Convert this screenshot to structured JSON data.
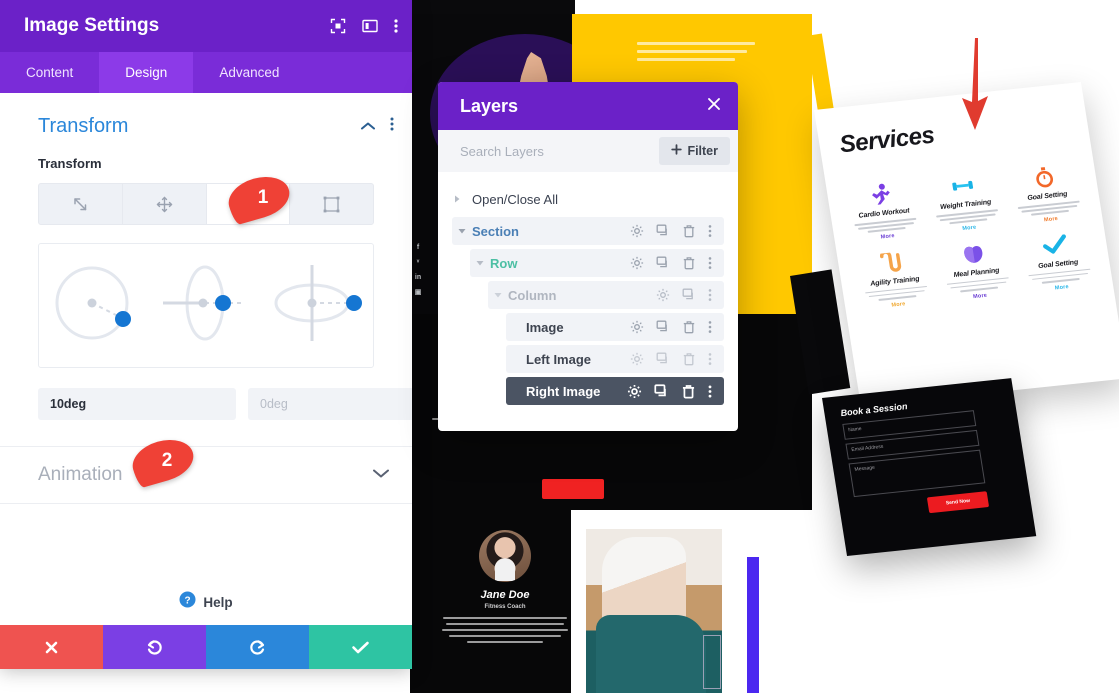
{
  "settings_panel": {
    "title": "Image Settings",
    "header_icons": [
      {
        "name": "focus-target-icon",
        "label": "Focus"
      },
      {
        "name": "panel-layout-icon",
        "label": "Panel Layout"
      },
      {
        "name": "kebab-menu-icon",
        "label": "More Options"
      }
    ],
    "tabs": [
      {
        "label": "Content",
        "active": false
      },
      {
        "label": "Design",
        "active": true
      },
      {
        "label": "Advanced",
        "active": false
      }
    ],
    "transform_section": {
      "heading": "Transform",
      "collapse_icon": "chevron-up-icon",
      "options_icon": "kebab-menu-icon",
      "sub_label": "Transform",
      "mode_buttons": [
        {
          "name": "scale",
          "icon": "scale-diagonal-icon",
          "active": false
        },
        {
          "name": "translate",
          "icon": "move-cross-icon",
          "active": false
        },
        {
          "name": "rotate",
          "icon": "rotate-circular-arrow-icon",
          "active": true
        },
        {
          "name": "skew",
          "icon": "skew-frame-icon",
          "active": false
        }
      ],
      "rotate_controls": [
        {
          "axis": "z",
          "label": "Rotate Z"
        },
        {
          "axis": "y",
          "label": "Rotate Y"
        },
        {
          "axis": "x",
          "label": "Rotate X"
        }
      ],
      "inputs": [
        {
          "name": "rotate-z",
          "value": "10deg",
          "placeholder": "0deg"
        },
        {
          "name": "rotate-y",
          "value": "",
          "placeholder": "0deg"
        },
        {
          "name": "rotate-x",
          "value": "",
          "placeholder": "0deg"
        }
      ]
    },
    "animation_section": {
      "heading": "Animation",
      "expand_icon": "chevron-down-icon"
    },
    "help": {
      "icon": "question-circle-icon",
      "label": "Help"
    },
    "footer_buttons": [
      {
        "name": "cancel",
        "icon": "close-x-icon",
        "color": "#ef5350"
      },
      {
        "name": "undo",
        "icon": "undo-arrow-icon",
        "color": "#7b3fe4"
      },
      {
        "name": "redo",
        "icon": "redo-arrow-icon",
        "color": "#2b87da"
      },
      {
        "name": "save",
        "icon": "checkmark-icon",
        "color": "#2ec4a3"
      }
    ]
  },
  "markers": [
    {
      "number": "1",
      "target": "rotate-transform-button"
    },
    {
      "number": "2",
      "target": "rotate-z-input"
    }
  ],
  "layers_modal": {
    "title": "Layers",
    "close_icon": "close-x-icon",
    "search": {
      "placeholder": "Search Layers",
      "value": ""
    },
    "filter_button": {
      "icon": "plus-icon",
      "label": "Filter"
    },
    "toggle_all": {
      "label": "Open/Close All",
      "icon": "caret-right-icon"
    },
    "rows": [
      {
        "label": "Section",
        "level": 1,
        "kind": "section",
        "caret": "caret-down-icon",
        "selected": false,
        "actions": [
          "gear-icon",
          "duplicate-icon",
          "trash-icon",
          "kebab-menu-icon"
        ]
      },
      {
        "label": "Row",
        "level": 2,
        "kind": "row",
        "caret": "caret-down-icon",
        "selected": false,
        "actions": [
          "gear-icon",
          "duplicate-icon",
          "trash-icon",
          "kebab-menu-icon"
        ]
      },
      {
        "label": "Column",
        "level": 3,
        "kind": "column",
        "caret": "caret-down-icon",
        "selected": false,
        "actions": [
          "gear-icon",
          "duplicate-icon",
          "kebab-menu-icon"
        ]
      },
      {
        "label": "Image",
        "level": 4,
        "kind": "module",
        "caret": "",
        "selected": false,
        "actions": [
          "gear-icon",
          "duplicate-icon",
          "trash-icon",
          "kebab-menu-icon"
        ]
      },
      {
        "label": "Left Image",
        "level": 4,
        "kind": "module",
        "caret": "",
        "selected": false,
        "actions": [
          "gear-icon",
          "duplicate-icon",
          "trash-icon",
          "kebab-menu-icon"
        ]
      },
      {
        "label": "Right Image",
        "level": 4,
        "kind": "module",
        "caret": "",
        "selected": true,
        "actions": [
          "gear-icon",
          "duplicate-icon",
          "trash-icon",
          "kebab-menu-icon"
        ]
      }
    ]
  },
  "page_preview": {
    "annotation_arrow": {
      "name": "red-down-arrow",
      "color": "#e03b2f"
    },
    "social_icons": [
      "f",
      "ᵛ",
      "in",
      "▣"
    ],
    "testimonial": {
      "name": "Jane Doe",
      "role": "Fitness Coach"
    },
    "services_card": {
      "title": "Services",
      "items": [
        {
          "label": "Cardio Workout",
          "icon": "running-person-icon",
          "link": "More",
          "link_color": "#6b3fd4"
        },
        {
          "label": "Weight Training",
          "icon": "dumbbell-icon",
          "link": "More",
          "link_color": "#29b6e8"
        },
        {
          "label": "Goal Setting",
          "icon": "stopwatch-icon",
          "link": "More",
          "link_color": "#f07c2d"
        },
        {
          "label": "Agility Training",
          "icon": "rope-icon",
          "link": "More",
          "link_color": "#f0a830"
        },
        {
          "label": "Meal Planning",
          "icon": "apple-icon",
          "link": "More",
          "link_color": "#6b3fd4"
        },
        {
          "label": "Goal Setting",
          "icon": "checkmark-thick-icon",
          "link": "More",
          "link_color": "#29b6e8"
        }
      ]
    },
    "booking_card": {
      "title": "Book a Session",
      "fields": [
        {
          "placeholder": "Name"
        },
        {
          "placeholder": "Email Address"
        },
        {
          "placeholder": "Message"
        }
      ],
      "submit_label": "Send Now"
    },
    "colors": {
      "yellow": "#ffc800",
      "black": "#07070a",
      "red": "#ec1b20",
      "blue_bar": "#4b28f0"
    }
  }
}
